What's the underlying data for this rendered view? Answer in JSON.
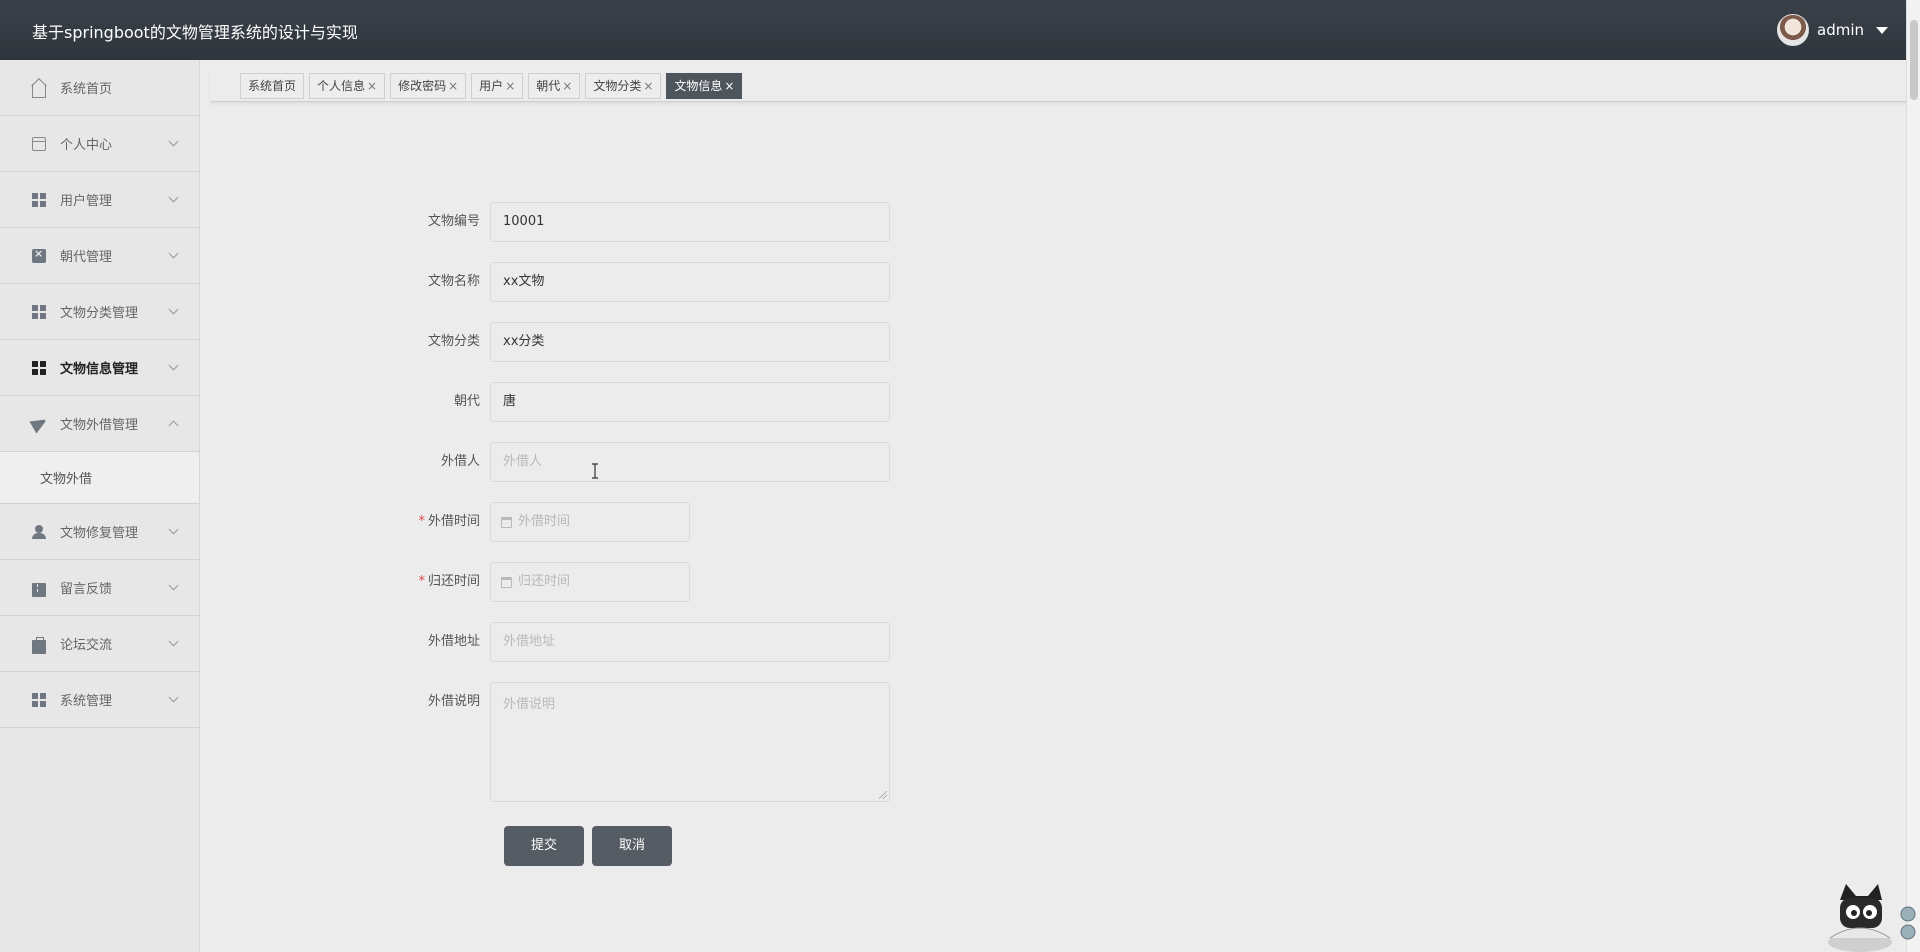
{
  "header": {
    "title": "基于springboot的文物管理系统的设计与实现",
    "user": "admin"
  },
  "sidebar": {
    "items": [
      {
        "label": "系统首页",
        "icon": "home-icon"
      },
      {
        "label": "个人中心",
        "icon": "card-icon"
      },
      {
        "label": "用户管理",
        "icon": "grid-icon"
      },
      {
        "label": "朝代管理",
        "icon": "clipboard-icon"
      },
      {
        "label": "文物分类管理",
        "icon": "grid-icon"
      },
      {
        "label": "文物信息管理",
        "icon": "grid-icon"
      },
      {
        "label": "文物外借管理",
        "icon": "send-icon"
      },
      {
        "label": "文物修复管理",
        "icon": "user-icon"
      },
      {
        "label": "留言反馈",
        "icon": "ticket-icon"
      },
      {
        "label": "论坛交流",
        "icon": "briefcase-icon"
      },
      {
        "label": "系统管理",
        "icon": "grid-icon"
      }
    ],
    "submenu": {
      "label": "文物外借"
    }
  },
  "tabs": [
    {
      "label": "系统首页",
      "x": ""
    },
    {
      "label": "个人信息",
      "x": "×"
    },
    {
      "label": "修改密码",
      "x": "×"
    },
    {
      "label": "用户",
      "x": "×"
    },
    {
      "label": "朝代",
      "x": "×"
    },
    {
      "label": "文物分类",
      "x": "×"
    },
    {
      "label": "文物信息",
      "x": "×"
    }
  ],
  "form": {
    "code": {
      "label": "文物编号",
      "value": "10001"
    },
    "name": {
      "label": "文物名称",
      "value": "xx文物"
    },
    "category": {
      "label": "文物分类",
      "value": "xx分类"
    },
    "dynasty": {
      "label": "朝代",
      "value": "唐"
    },
    "borrower": {
      "label": "外借人",
      "placeholder": "外借人"
    },
    "borrow_time": {
      "label": "外借时间",
      "placeholder": "外借时间"
    },
    "return_time": {
      "label": "归还时间",
      "placeholder": "归还时间"
    },
    "address": {
      "label": "外借地址",
      "placeholder": "外借地址"
    },
    "note": {
      "label": "外借说明",
      "placeholder": "外借说明"
    },
    "required_mark": "*"
  },
  "buttons": {
    "submit": "提交",
    "cancel": "取消"
  }
}
